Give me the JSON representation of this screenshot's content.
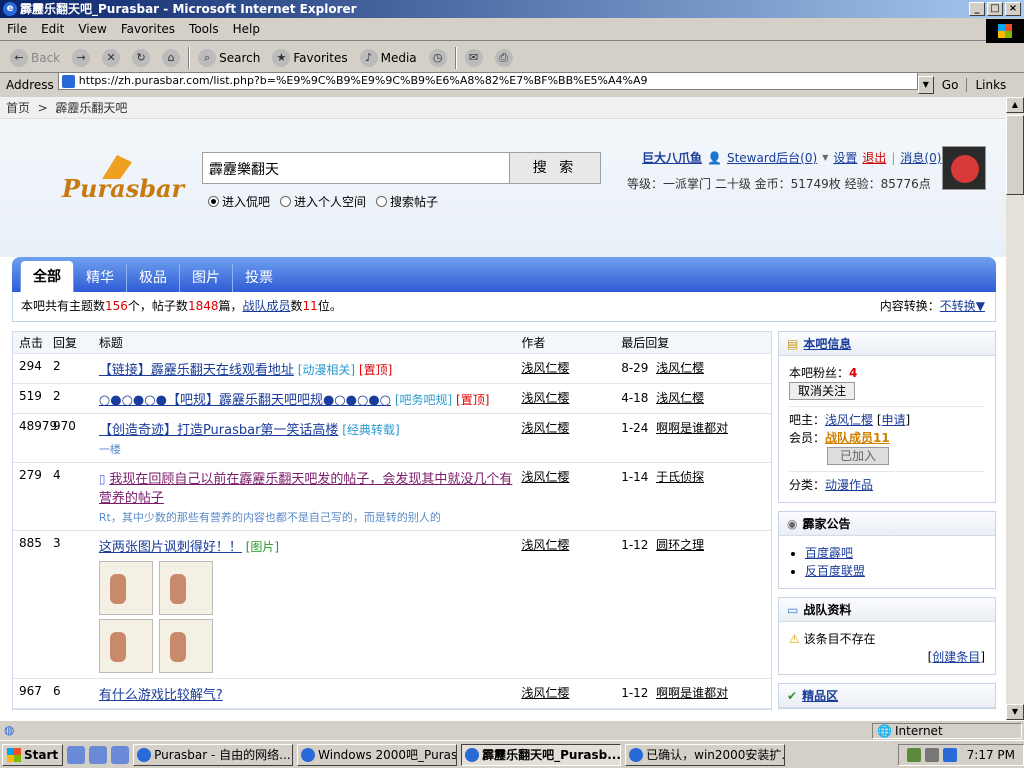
{
  "window": {
    "title": "霹靂乐翻天吧_Purasbar - Microsoft Internet Explorer",
    "ie_glyph": "e"
  },
  "menu": [
    "File",
    "Edit",
    "View",
    "Favorites",
    "Tools",
    "Help"
  ],
  "toolbar": {
    "back": "Back",
    "search": "Search",
    "favorites": "Favorites",
    "media": "Media"
  },
  "address": {
    "label": "Address",
    "url": "https://zh.purasbar.com/list.php?b=%E9%9C%B9%E9%9C%B9%E6%A8%82%E7%BF%BB%E5%A4%A9",
    "go": "Go",
    "links": "Links"
  },
  "breadcrumb": {
    "home": "首页",
    "sep": ">",
    "current": "霹靂乐翻天吧"
  },
  "header": {
    "logo": "Purasbar",
    "search_value": "霹靂樂翻天",
    "search_button": "搜 索",
    "radios": [
      "进入侃吧",
      "进入个人空间",
      "搜索帖子"
    ],
    "username": "巨大八爪鱼",
    "steward": "Steward后台(0)",
    "settings": "设置",
    "logout": "退出",
    "messages": "消息(0)",
    "stats": "等级：一派掌门  二十级  金币：51749枚  经验：85776点"
  },
  "tabs": [
    "全部",
    "精华",
    "极品",
    "图片",
    "投票"
  ],
  "info": {
    "prefix": "本吧共有主题数",
    "topics": "156",
    "mid": "个，帖子数",
    "posts": "1848",
    "mid2": "篇，",
    "team": "战队成员",
    "mid3": "数",
    "members": "11",
    "suffix": "位。",
    "convert_label": "内容转换：",
    "convert_value": "不转换▼"
  },
  "list": {
    "headers": [
      "点击",
      "回复",
      "标题",
      "作者",
      "最后回复"
    ],
    "rows": [
      {
        "clicks": "294",
        "replies": "2",
        "title": "【链接】霹靂乐翻天在线观看地址",
        "tag": "[动漫相关]",
        "tag2": "[置顶]",
        "sub": "",
        "author": "浅风仁樱",
        "date": "8-29",
        "last": "浅风仁樱"
      },
      {
        "clicks": "519",
        "replies": "2",
        "title": "○●○●○●【吧规】霹靂乐翻天吧吧规●○●○●○",
        "tag": "[吧务吧规]",
        "tag2": "[置顶]",
        "sub": "",
        "author": "浅风仁樱",
        "date": "4-18",
        "last": "浅风仁樱"
      },
      {
        "clicks": "48979",
        "replies": "970",
        "title": "【创造奇迹】打造Purasbar第一笑话高楼",
        "tag": "[经典转载]",
        "tag2": "",
        "sub": "一楼",
        "author": "浅风仁樱",
        "date": "1-24",
        "last": "啊啊是谁都对"
      },
      {
        "clicks": "279",
        "replies": "4",
        "title": "我现在回顾自己以前在霹靂乐翻天吧发的帖子，会发现其中就没几个有营养的帖子",
        "tag": "",
        "tag2": "",
        "sub": "Rt，其中少数的那些有营养的内容也都不是自己写的，而是转的别人的",
        "author": "浅风仁樱",
        "date": "1-14",
        "last": "于氏侦探"
      },
      {
        "clicks": "885",
        "replies": "3",
        "title": "这两张图片讽刺得好！！",
        "tag": "[图片]",
        "tag2": "",
        "sub": "",
        "author": "浅风仁樱",
        "date": "1-12",
        "last": "圆环之理"
      },
      {
        "clicks": "967",
        "replies": "6",
        "title": "有什么游戏比较解气?",
        "tag": "",
        "tag2": "",
        "sub": "",
        "author": "浅风仁樱",
        "date": "1-12",
        "last": "啊啊是谁都对"
      }
    ]
  },
  "sidebar": {
    "bar_info": {
      "title": "本吧信息",
      "fans_label": "本吧粉丝：",
      "fans": "4",
      "unfollow": "取消关注",
      "owner_label": "吧主：",
      "owner": "浅风仁樱",
      "apply": "申请",
      "member_label": "会员：",
      "member": "战队成员11",
      "joined": "已加入",
      "category_label": "分类：",
      "category": "动漫作品"
    },
    "notice": {
      "title": "霹家公告",
      "items": [
        "百度霹吧",
        "反百度联盟"
      ]
    },
    "team": {
      "title": "战队资料",
      "empty": "该条目不存在",
      "create": "创建条目"
    },
    "featured": {
      "title": "精品区"
    }
  },
  "status": {
    "zone": "Internet"
  },
  "taskbar": {
    "start": "Start",
    "tasks": [
      "Purasbar - 自由的网络...",
      "Windows 2000吧_Purasb...",
      "霹靂乐翻天吧_Purasb...",
      "已确认，win2000安装扩..."
    ],
    "clock": "7:17 PM"
  }
}
